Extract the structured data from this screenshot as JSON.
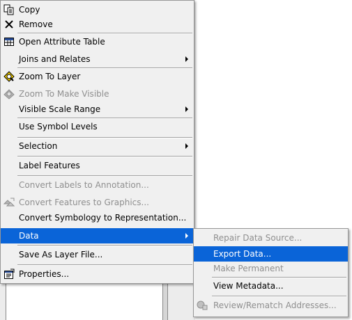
{
  "context_menu": {
    "items": [
      {
        "label": "Copy",
        "icon": "copy-icon"
      },
      {
        "label": "Remove",
        "icon": "remove-icon"
      },
      {
        "label": "Open Attribute Table",
        "icon": "table-icon"
      },
      {
        "label": "Joins and Relates",
        "has_submenu": true
      },
      {
        "label": "Zoom To Layer",
        "icon": "zoom-to-layer-icon"
      },
      {
        "label": "Zoom To Make Visible",
        "icon": "zoom-visible-icon",
        "disabled": true
      },
      {
        "label": "Visible Scale Range",
        "has_submenu": true
      },
      {
        "label": "Use Symbol Levels"
      },
      {
        "label": "Selection",
        "has_submenu": true
      },
      {
        "label": "Label Features"
      },
      {
        "label": "Convert Labels to Annotation...",
        "disabled": true
      },
      {
        "label": "Convert Features to Graphics...",
        "icon": "convert-graphics-icon",
        "disabled": true
      },
      {
        "label": "Convert Symbology to Representation..."
      },
      {
        "label": "Data",
        "has_submenu": true,
        "highlighted": true
      },
      {
        "label": "Save As Layer File..."
      },
      {
        "label": "Properties...",
        "icon": "properties-icon"
      }
    ]
  },
  "data_submenu": {
    "items": [
      {
        "label": "Repair Data Source...",
        "disabled": true
      },
      {
        "label": "Export Data...",
        "highlighted": true
      },
      {
        "label": "Make Permanent",
        "disabled": true
      },
      {
        "label": "View Metadata..."
      },
      {
        "label": "Review/Rematch Addresses...",
        "icon": "geocode-icon",
        "disabled": true
      }
    ]
  },
  "colors": {
    "highlight": "#0a64d8",
    "menu_background": "#f0f0f0",
    "disabled_text": "#8f8f8f"
  }
}
